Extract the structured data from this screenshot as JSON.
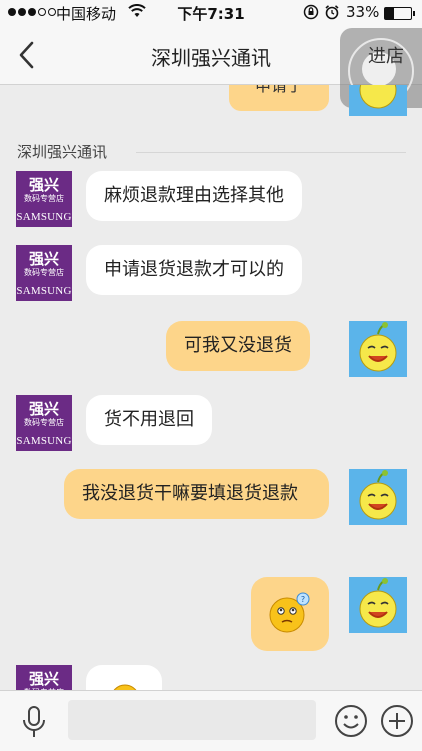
{
  "status_bar": {
    "carrier": "中国移动",
    "time": "下午7:31",
    "battery_percent": "33%",
    "battery_level": 0.33,
    "icons": [
      "signal-dots-icon",
      "wifi-icon",
      "rotation-lock-icon",
      "alarm-icon",
      "battery-icon"
    ]
  },
  "nav": {
    "title": "深圳强兴通讯",
    "enter_shop_label": "进店",
    "back_icon": "chevron-left-icon"
  },
  "chat": {
    "partial_bubble_text": "申请了",
    "sender_name": "深圳强兴通讯",
    "shop_avatar": {
      "brand": "强兴",
      "sub": "数码专营店",
      "samsung": "SAMSUNG",
      "color": "#6b2b85"
    },
    "messages": [
      {
        "side": "in",
        "text": "麻烦退款理由选择其他"
      },
      {
        "side": "in",
        "text": "申请退货退款才可以的"
      },
      {
        "side": "out",
        "text": "可我又没退货"
      },
      {
        "side": "in",
        "text": "货不用退回"
      },
      {
        "side": "out",
        "text": "我没退货干嘛要填退货退款"
      },
      {
        "side": "out",
        "type": "emoji",
        "emoji": "confused-face-emoji"
      },
      {
        "side": "in",
        "type": "emoji",
        "emoji": "face-emoji"
      }
    ],
    "colors": {
      "incoming_bubble": "#ffffff",
      "outgoing_bubble": "#fdd58a",
      "my_avatar_bg": "#5bb4ea"
    }
  },
  "input_bar": {
    "placeholder": "",
    "icons": [
      "microphone-icon",
      "emoji-icon",
      "plus-icon"
    ]
  }
}
